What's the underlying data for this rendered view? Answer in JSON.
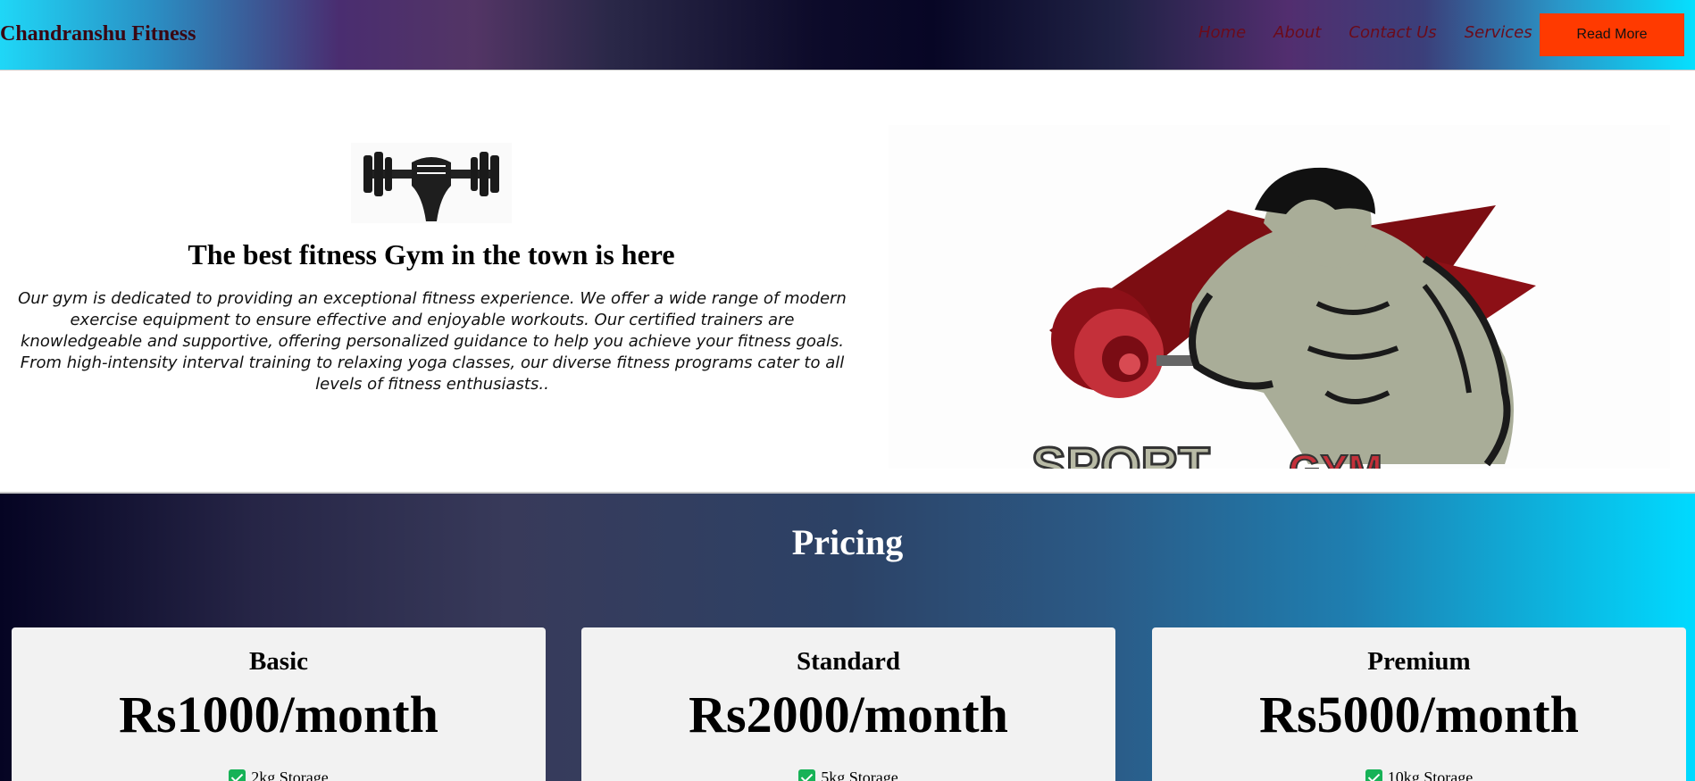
{
  "header": {
    "brand": "Chandranshu Fitness",
    "nav": [
      "Home",
      "About",
      "Contact Us",
      "Services"
    ],
    "cta": "Read More"
  },
  "hero": {
    "title": "The best fitness Gym in the town is here",
    "description": "Our gym is dedicated to providing an exceptional fitness experience. We offer a wide range of modern exercise equipment to ensure effective and enjoyable workouts. Our certified trainers are knowledgeable and supportive, offering personalized guidance to help you achieve your fitness goals. From high-intensity interval training to relaxing yoga classes, our diverse fitness programs cater to all levels of fitness enthusiasts..",
    "logo_icon": "dumbbell-fist-icon",
    "image_text_1": "SPORT",
    "image_text_2": "GYM"
  },
  "pricing": {
    "title": "Pricing",
    "plans": [
      {
        "name": "Basic",
        "price": "Rs1000/month",
        "feature": "2kg Storage"
      },
      {
        "name": "Standard",
        "price": "Rs2000/month",
        "feature": "5kg Storage"
      },
      {
        "name": "Premium",
        "price": "Rs5000/month",
        "feature": "10kg Storage"
      }
    ]
  },
  "colors": {
    "cta_bg": "#ff3a00",
    "nav_text": "#6b0b1a",
    "brand_text": "#3a0712",
    "check_green": "#17b257",
    "card_bg": "#f2f2f2"
  }
}
